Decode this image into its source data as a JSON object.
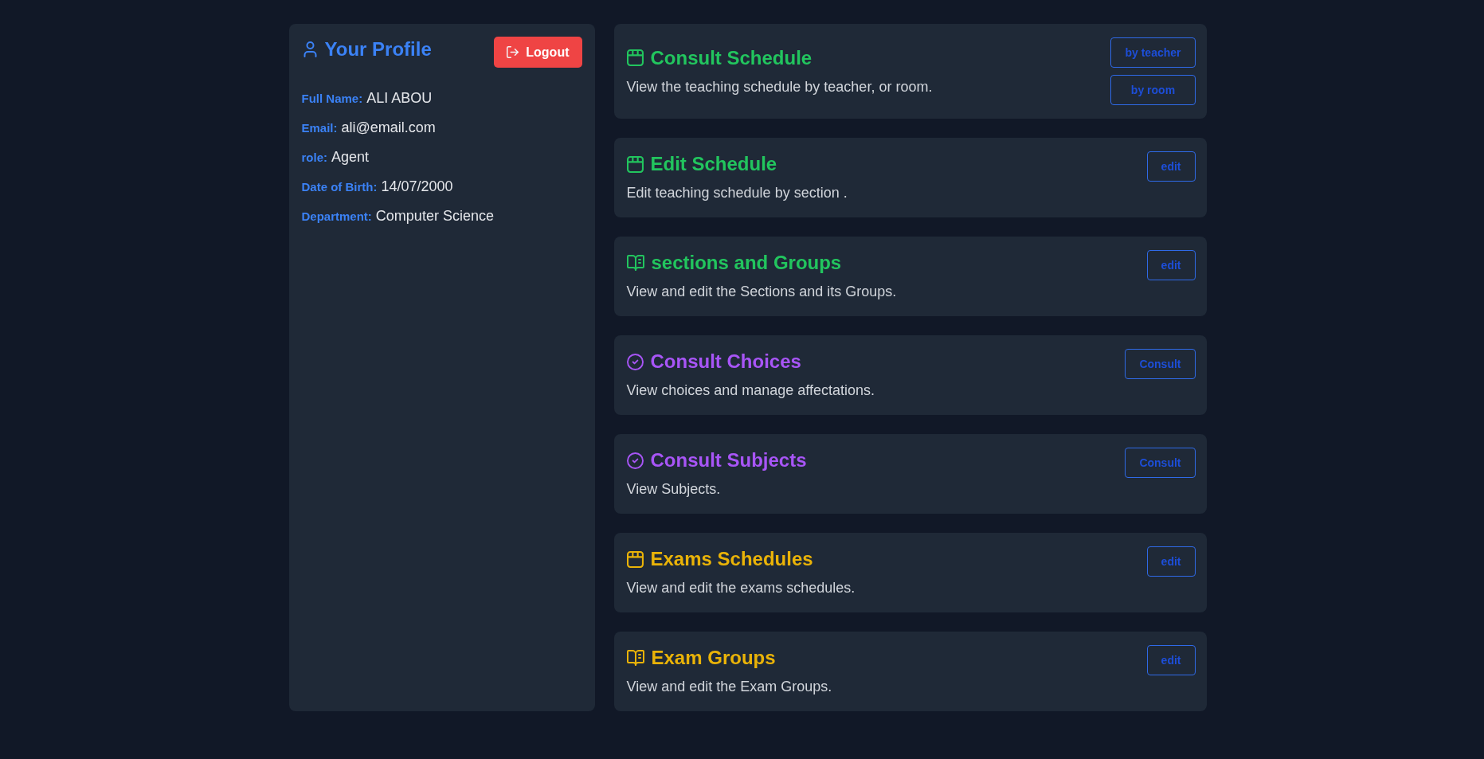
{
  "profile": {
    "title": "Your Profile",
    "logout": "Logout",
    "fields": [
      {
        "label": "Full Name:",
        "value": "ALI ABOU"
      },
      {
        "label": "Email:",
        "value": "ali@email.com"
      },
      {
        "label": "role:",
        "value": "Agent"
      },
      {
        "label": "Date of Birth:",
        "value": "14/07/2000"
      },
      {
        "label": "Department:",
        "value": "Computer Science"
      }
    ]
  },
  "cards": [
    {
      "kind": "schedule",
      "color": "#22c55e",
      "title": "Consult Schedule",
      "description": "View the teaching schedule by teacher, or room.",
      "buttons": [
        "by teacher",
        "by room"
      ]
    },
    {
      "kind": "schedule",
      "color": "#22c55e",
      "title": "Edit Schedule",
      "description": "Edit teaching schedule by section .",
      "buttons": [
        "edit"
      ]
    },
    {
      "kind": "groups",
      "color": "#22c55e",
      "title": "sections and Groups",
      "description": "View and edit the Sections and its Groups.",
      "buttons": [
        "edit"
      ]
    },
    {
      "kind": "consult",
      "color": "#a855f7",
      "title": "Consult Choices",
      "description": "View choices and manage affectations.",
      "buttons": [
        "Consult"
      ]
    },
    {
      "kind": "consult",
      "color": "#a855f7",
      "title": "Consult Subjects",
      "description": "View Subjects.",
      "buttons": [
        "Consult"
      ]
    },
    {
      "kind": "schedule",
      "color": "#eab308",
      "title": "Exams Schedules",
      "description": "View and edit the exams schedules.",
      "buttons": [
        "edit"
      ]
    },
    {
      "kind": "groups",
      "color": "#eab308",
      "title": "Exam Groups",
      "description": "View and edit the Exam Groups.",
      "buttons": [
        "edit"
      ]
    }
  ]
}
